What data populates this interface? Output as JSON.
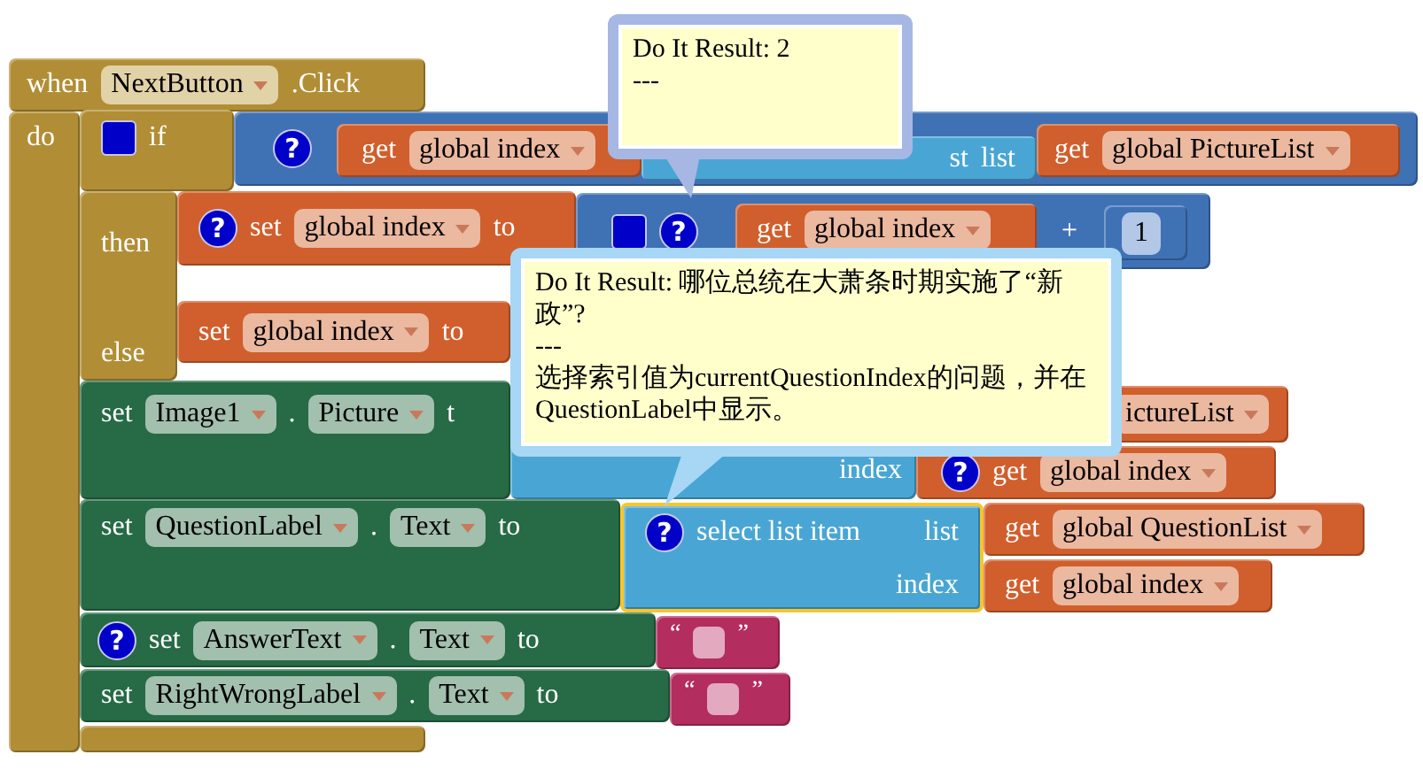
{
  "blocks": [
    {
      "kind": "event",
      "selected": false,
      "lines": [
        {
          "parts": [
            {
              "kind": "label",
              "text": "when"
            },
            {
              "kind": "dropdown",
              "text": "NextButton"
            },
            {
              "kind": "label",
              "text": ".Click"
            }
          ]
        },
        {
          "parts": [
            {
              "kind": "label",
              "text": "do"
            }
          ]
        }
      ]
    },
    {
      "kind": "control",
      "selected": false,
      "lines": [
        {
          "parts": [
            {
              "kind": "mutator"
            },
            {
              "kind": "label",
              "text": "if"
            }
          ]
        },
        {
          "parts": [
            {
              "kind": "label",
              "text": "then"
            }
          ]
        },
        {
          "parts": [
            {
              "kind": "label",
              "text": "else"
            }
          ]
        }
      ]
    },
    {
      "kind": "math",
      "selected": false,
      "lines": [
        {
          "parts": [
            {
              "kind": "help",
              "text": "?"
            }
          ]
        }
      ],
      "children": [
        {
          "kind": "variable",
          "selected": false,
          "lines": [
            {
              "parts": [
                {
                  "kind": "label",
                  "text": "get"
                },
                {
                  "kind": "dropdown",
                  "text": "global index"
                }
              ]
            }
          ]
        },
        {
          "kind": "list",
          "selected": false,
          "lines": [
            {
              "parts": [
                {
                  "kind": "label",
                  "text": "st"
                },
                {
                  "kind": "label",
                  "text": "list"
                }
              ]
            }
          ]
        },
        {
          "kind": "variable",
          "selected": false,
          "lines": [
            {
              "parts": [
                {
                  "kind": "label",
                  "text": "get"
                },
                {
                  "kind": "dropdown",
                  "text": "global PictureList"
                }
              ]
            }
          ]
        }
      ]
    },
    {
      "kind": "variable",
      "selected": false,
      "lines": [
        {
          "parts": [
            {
              "kind": "help",
              "text": "?"
            },
            {
              "kind": "label",
              "text": "set"
            },
            {
              "kind": "dropdown",
              "text": "global index"
            },
            {
              "kind": "label",
              "text": "to"
            }
          ]
        }
      ]
    },
    {
      "kind": "math",
      "selected": false,
      "lines": [
        {
          "parts": [
            {
              "kind": "mutator"
            },
            {
              "kind": "help",
              "text": "?"
            },
            {
              "kind": "label",
              "text": "+"
            }
          ]
        }
      ],
      "children": [
        {
          "kind": "variable",
          "selected": false,
          "lines": [
            {
              "parts": [
                {
                  "kind": "label",
                  "text": "get"
                },
                {
                  "kind": "dropdown",
                  "text": "global index"
                }
              ]
            }
          ]
        },
        {
          "kind": "math",
          "selected": false,
          "lines": [
            {
              "parts": [
                {
                  "kind": "number",
                  "text": "1"
                }
              ]
            }
          ]
        }
      ]
    },
    {
      "kind": "variable",
      "selected": false,
      "lines": [
        {
          "parts": [
            {
              "kind": "label",
              "text": "set"
            },
            {
              "kind": "dropdown",
              "text": "global index"
            },
            {
              "kind": "label",
              "text": "to"
            }
          ]
        }
      ]
    },
    {
      "kind": "component",
      "selected": false,
      "lines": [
        {
          "parts": [
            {
              "kind": "label",
              "text": "set"
            },
            {
              "kind": "dropdown",
              "text": "Image1"
            },
            {
              "kind": "label",
              "text": "."
            },
            {
              "kind": "dropdown",
              "text": "Picture"
            },
            {
              "kind": "label",
              "text": "t"
            }
          ]
        }
      ]
    },
    {
      "kind": "list",
      "selected": false,
      "lines": [
        {
          "parts": [
            {
              "kind": "label",
              "text": "index"
            }
          ]
        }
      ]
    },
    {
      "kind": "variable",
      "selected": false,
      "lines": [
        {
          "parts": [
            {
              "kind": "dropdown",
              "text": "ictureList"
            }
          ]
        }
      ]
    },
    {
      "kind": "variable",
      "selected": false,
      "lines": [
        {
          "parts": [
            {
              "kind": "help",
              "text": "?"
            },
            {
              "kind": "label",
              "text": "get"
            },
            {
              "kind": "dropdown",
              "text": "global index"
            }
          ]
        }
      ]
    },
    {
      "kind": "component",
      "selected": false,
      "lines": [
        {
          "parts": [
            {
              "kind": "label",
              "text": "set"
            },
            {
              "kind": "dropdown",
              "text": "QuestionLabel"
            },
            {
              "kind": "label",
              "text": "."
            },
            {
              "kind": "dropdown",
              "text": "Text"
            },
            {
              "kind": "label",
              "text": "to"
            }
          ]
        }
      ]
    },
    {
      "kind": "list",
      "selected": true,
      "lines": [
        {
          "parts": [
            {
              "kind": "help",
              "text": "?"
            },
            {
              "kind": "label",
              "text": "select list item"
            },
            {
              "kind": "label",
              "text": "list"
            }
          ]
        },
        {
          "parts": [
            {
              "kind": "label",
              "text": "index"
            }
          ]
        }
      ]
    },
    {
      "kind": "variable",
      "selected": false,
      "lines": [
        {
          "parts": [
            {
              "kind": "label",
              "text": "get"
            },
            {
              "kind": "dropdown",
              "text": "global QuestionList"
            }
          ]
        }
      ]
    },
    {
      "kind": "variable",
      "selected": false,
      "lines": [
        {
          "parts": [
            {
              "kind": "label",
              "text": "get"
            },
            {
              "kind": "dropdown",
              "text": "global index"
            }
          ]
        }
      ]
    },
    {
      "kind": "component",
      "selected": false,
      "lines": [
        {
          "parts": [
            {
              "kind": "help",
              "text": "?"
            },
            {
              "kind": "label",
              "text": "set"
            },
            {
              "kind": "dropdown",
              "text": "AnswerText"
            },
            {
              "kind": "label",
              "text": "."
            },
            {
              "kind": "dropdown",
              "text": "Text"
            },
            {
              "kind": "label",
              "text": "to"
            }
          ]
        }
      ]
    },
    {
      "kind": "text",
      "selected": false,
      "lines": [
        {
          "parts": [
            {
              "kind": "quote",
              "text": "“"
            },
            {
              "kind": "text_field"
            },
            {
              "kind": "quote",
              "text": "”"
            }
          ]
        }
      ]
    },
    {
      "kind": "component",
      "selected": false,
      "lines": [
        {
          "parts": [
            {
              "kind": "label",
              "text": "set"
            },
            {
              "kind": "dropdown",
              "text": "RightWrongLabel"
            },
            {
              "kind": "label",
              "text": "."
            },
            {
              "kind": "dropdown",
              "text": "Text"
            },
            {
              "kind": "label",
              "text": "to"
            }
          ]
        }
      ]
    },
    {
      "kind": "text",
      "selected": false,
      "lines": [
        {
          "parts": [
            {
              "kind": "quote",
              "text": "“"
            },
            {
              "kind": "text_field"
            },
            {
              "kind": "quote",
              "text": "”"
            }
          ]
        }
      ]
    }
  ],
  "bubbles": [
    {
      "lines": [
        "Do It Result: 2",
        "---"
      ]
    },
    {
      "lines": [
        "Do It Result: 哪位总统在大萧条时期实施了“新政”?",
        "---",
        "选择索引值为currentQuestionIndex的问题，并在QuestionLabel中显示。"
      ]
    }
  ]
}
